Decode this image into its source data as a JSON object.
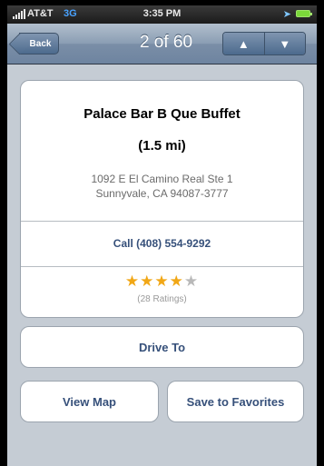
{
  "status_bar": {
    "carrier": "AT&T",
    "network": "3G",
    "time": "3:35 PM"
  },
  "nav": {
    "back_label": "Back",
    "title": "2 of 60",
    "up_symbol": "▲",
    "down_symbol": "▼"
  },
  "place": {
    "name": "Palace Bar B Que Buffet",
    "distance": "(1.5 mi)",
    "address_line1": "1092 E El Camino Real Ste 1",
    "address_line2": "Sunnyvale, CA 94087-3777",
    "call_label": "Call (408) 554-9292",
    "rating_stars": 4,
    "rating_max": 5,
    "ratings_count": "(28 Ratings)"
  },
  "actions": {
    "drive_to": "Drive To",
    "view_map": "View Map",
    "save_favorites": "Save to Favorites"
  },
  "colors": {
    "link": "#36507a",
    "star": "#f1a716",
    "nav": "#6e84a0"
  }
}
